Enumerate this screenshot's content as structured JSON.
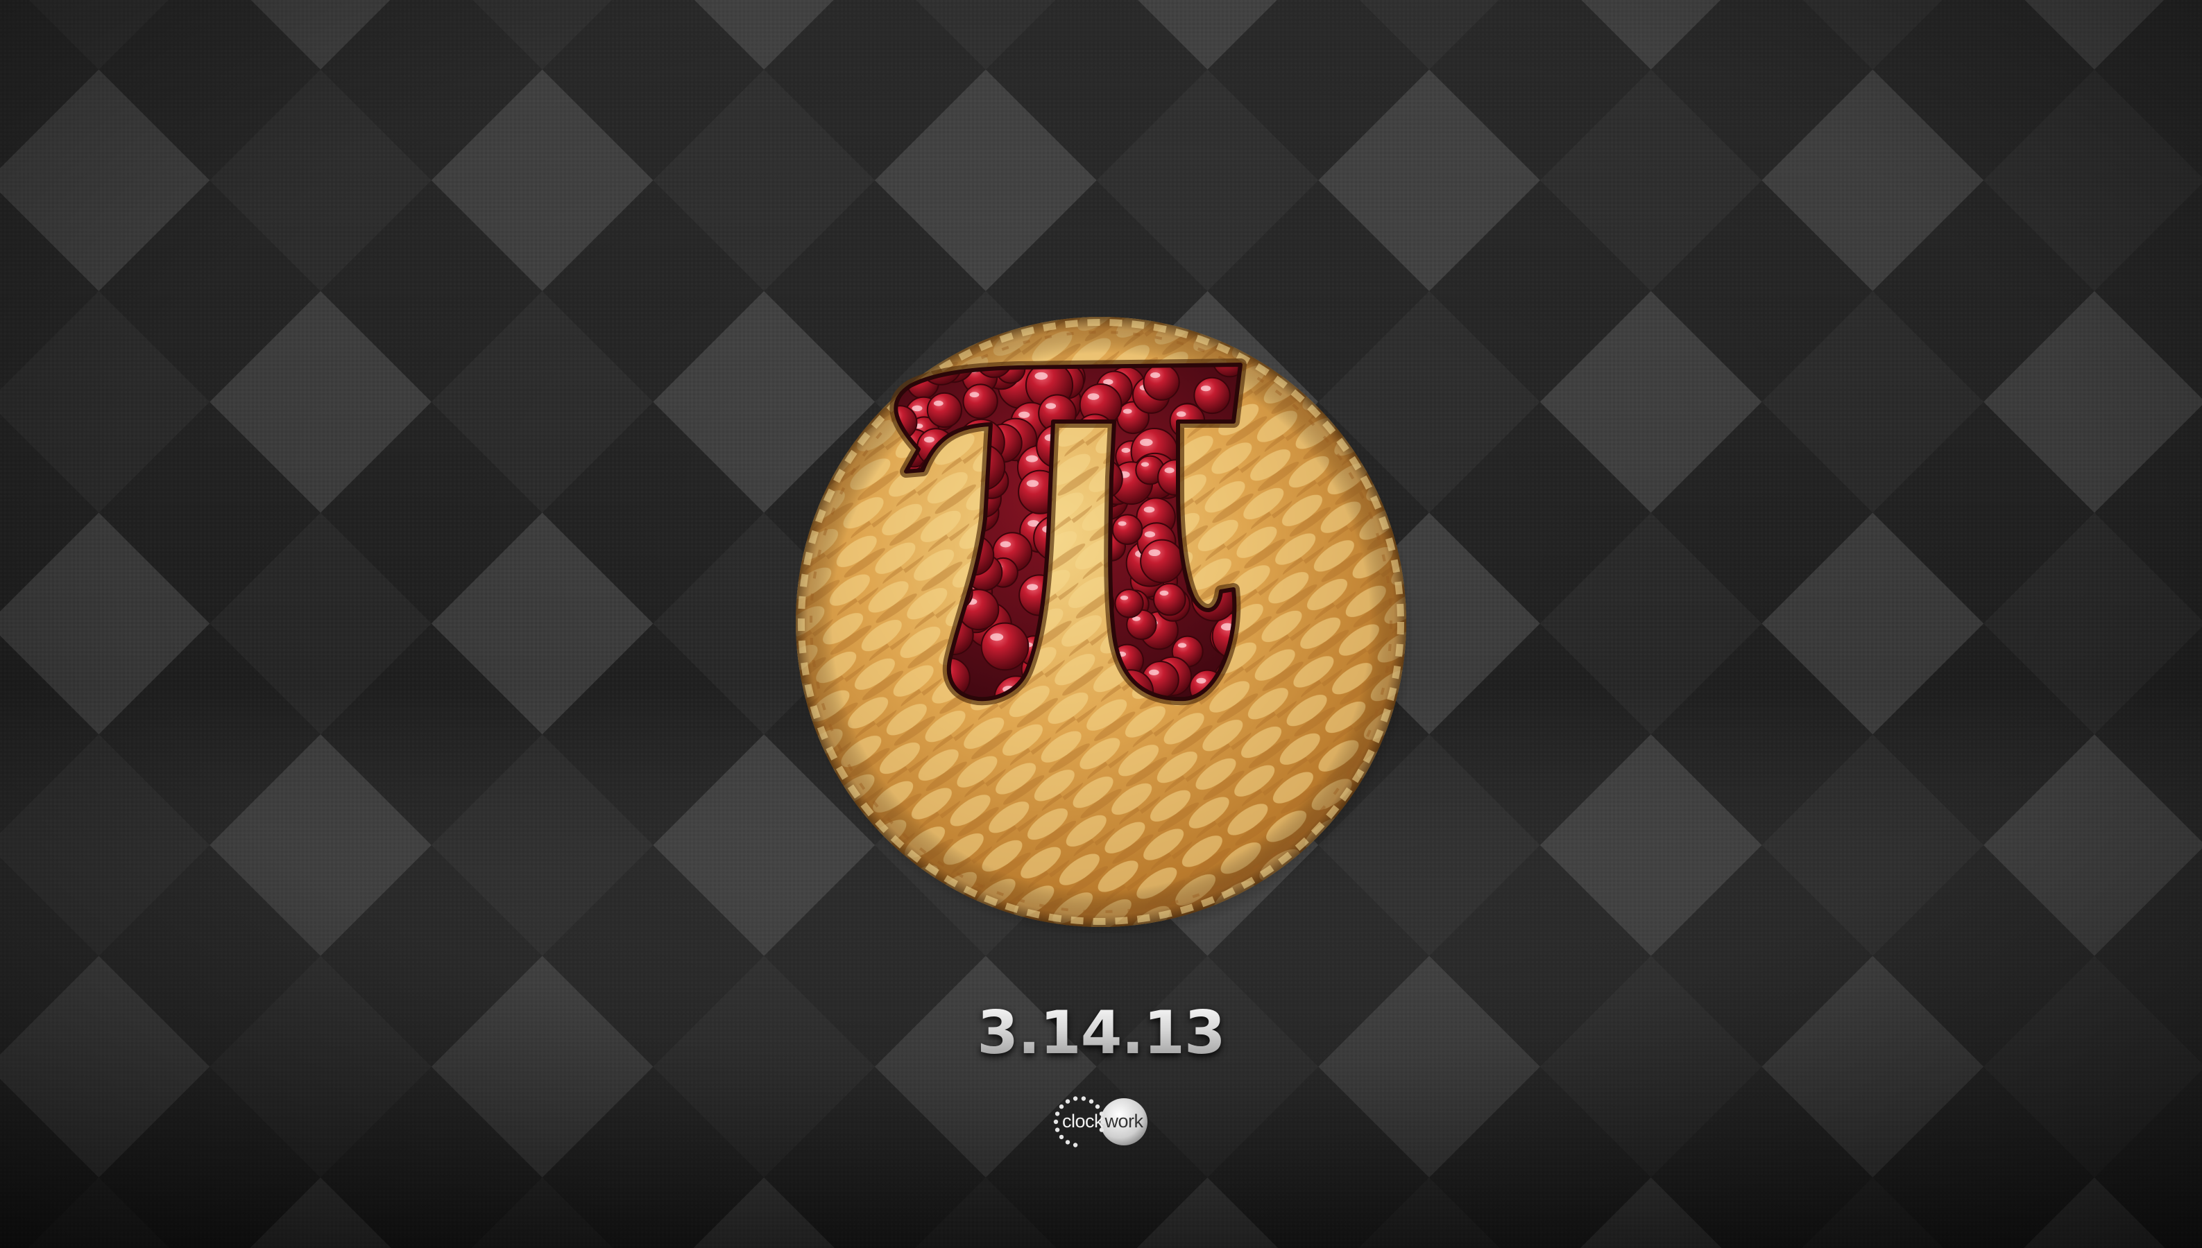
{
  "poster": {
    "date": "3.14.13",
    "symbol": "π"
  },
  "logo": {
    "part1": "clock",
    "part2": "work"
  },
  "colors": {
    "background_dark": "#141414",
    "background_light": "#4a4a4a",
    "crust": "#d9a04a",
    "crust_highlight": "#f6dc95",
    "filling": "#7a0f1c",
    "cherry": "#b01628",
    "text": "#dcdcdc"
  },
  "icons": {
    "pie": "cherry-pie-icon",
    "pi": "pi-symbol-icon",
    "logo_dots": "dotted-circle-icon"
  }
}
